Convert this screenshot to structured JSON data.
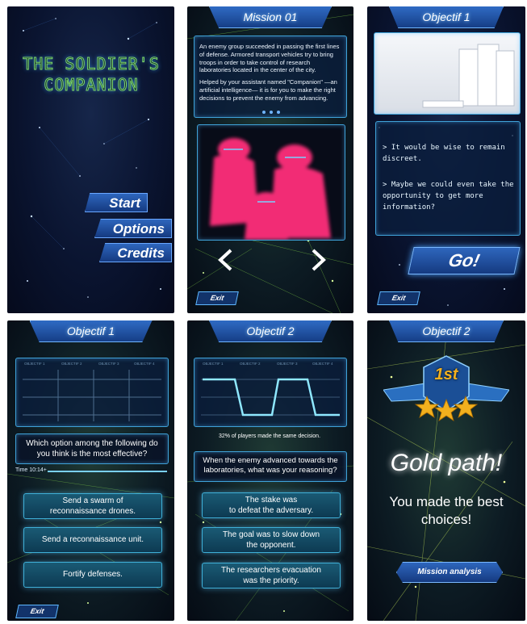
{
  "panels": {
    "title_screen": {
      "game_title": "THE SOLDIER'S COMPANION",
      "menu": [
        "Start",
        "Options",
        "Credits"
      ]
    },
    "mission_briefing": {
      "header": "Mission 01",
      "paragraph1": "An enemy group succeeded in passing the first lines of defense. Armored transport vehicles try to bring troops in order to take control of research laboratories located in the center of the city.",
      "paragraph2": "Helped by your assistant named \"Companion\" —an artificial intelligence— it is for you to make the right decisions to prevent the enemy from advancing.",
      "prev_icon": "chevron-left-icon",
      "next_icon": "chevron-right-icon",
      "exit_label": "Exit"
    },
    "objective_screen": {
      "header": "Objectif 1",
      "line1": "> It would be wise to remain discreet.",
      "line2": "> Maybe we could even take the opportunity to get more information?",
      "go_label": "Go!",
      "exit_label": "Exit"
    },
    "question_screen": {
      "header": "Objectif 1",
      "track_labels": [
        "OBJECTIF 1",
        "OBJECTIF 2",
        "OBJECTIF 3",
        "OBJECTIF 4"
      ],
      "question": "Which option among the following do you think is the most effective?",
      "timer": "Time  10:14+",
      "options": [
        "Send a swarm of\nreconnaissance drones.",
        "Send a reconnaissance unit.",
        "Fortify defenses."
      ],
      "exit_label": "Exit"
    },
    "reasoning_screen": {
      "header": "Objectif 2",
      "track_labels": [
        "OBJECTIF 1",
        "OBJECTIF 2",
        "OBJECTIF 3",
        "OBJECTIF 4"
      ],
      "stat": "32% of players made the same decision.",
      "question": "When the enemy advanced towards the laboratories, what was your reasoning?",
      "options": [
        "The stake was\nto defeat the adversary.",
        "The goal was to slow down\nthe opponent.",
        "The researchers evacuation\nwas the priority."
      ]
    },
    "result_screen": {
      "header": "Objectif 2",
      "rank_badge": "1st",
      "result_title": "Gold path!",
      "result_message": "You made the best choices!",
      "analysis_label": "Mission analysis"
    }
  },
  "colors": {
    "accent_blue": "#2f6bc4",
    "glow_cyan": "#3fb0d8",
    "gold": "#f2b01e",
    "magenta": "#ff2f7a"
  }
}
